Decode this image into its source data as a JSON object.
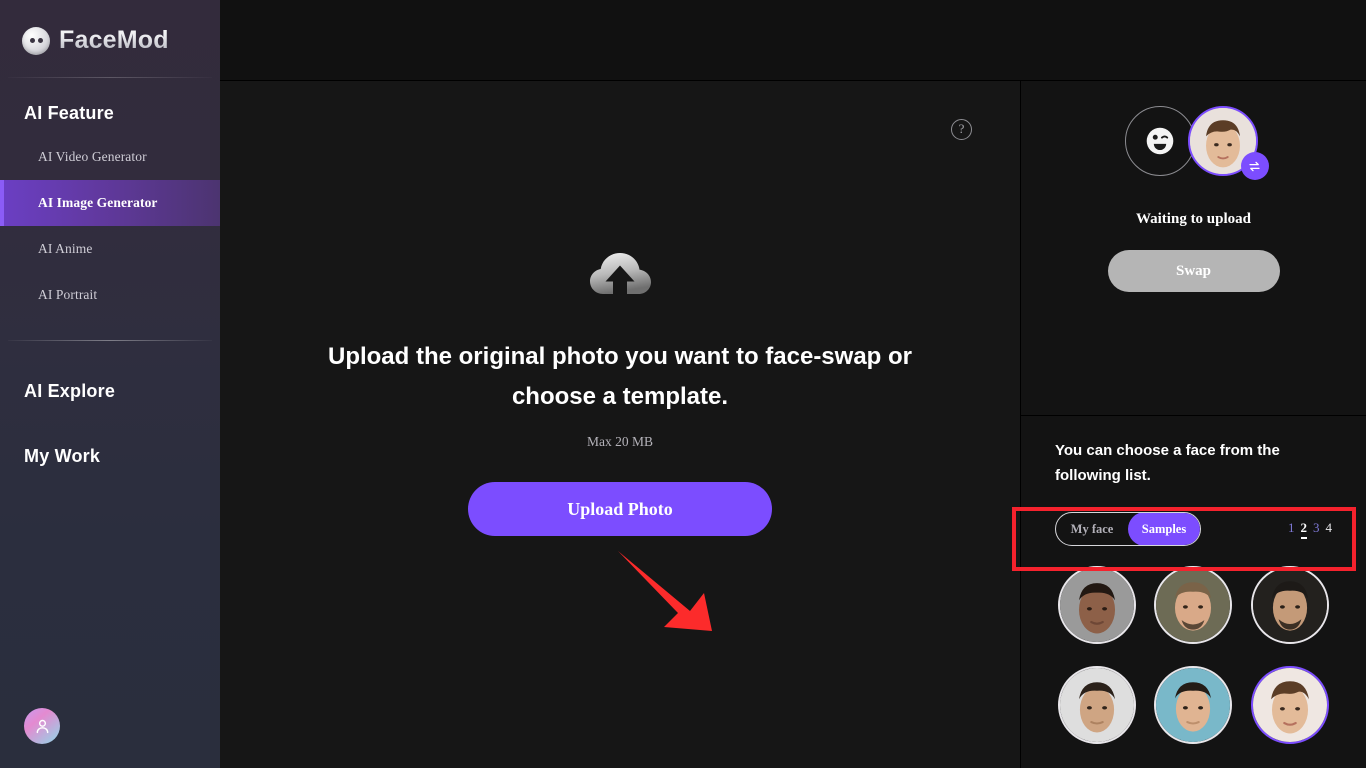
{
  "brand": {
    "name": "FaceMod",
    "logo_icon": "face-circle-icon"
  },
  "sidebar": {
    "section_feature_title": "AI Feature",
    "nav_items": [
      {
        "label": "AI Video Generator",
        "active": false
      },
      {
        "label": "AI Image Generator",
        "active": true
      },
      {
        "label": "AI Anime",
        "active": false
      },
      {
        "label": "AI Portrait",
        "active": false
      }
    ],
    "explore_label": "AI Explore",
    "my_work_label": "My Work",
    "avatar_icon": "user-avatar-icon"
  },
  "main": {
    "help_icon": "question-mark-icon",
    "upload_icon": "cloud-upload-icon",
    "headline": "Upload the original photo you want to face-swap or choose a template.",
    "max_size": "Max 20 MB",
    "upload_button": "Upload Photo",
    "annotation_arrow": "red-arrow-pointing-to-upload-button"
  },
  "right_panel": {
    "source_face_icon": "winking-face-placeholder-icon",
    "target_face": "selected-face-thumbnail",
    "swap_toggle_icon": "swap-arrows-icon",
    "status_text": "Waiting to upload",
    "swap_button": "Swap",
    "swap_button_state": "disabled",
    "choose_text": "You can choose a face from the following list.",
    "segmented": {
      "options": [
        {
          "label": "My face",
          "active": false
        },
        {
          "label": "Samples",
          "active": true
        }
      ]
    },
    "pagination": {
      "pages": [
        {
          "label": "1",
          "active": false,
          "style": "link"
        },
        {
          "label": "2",
          "active": true,
          "style": "current"
        },
        {
          "label": "3",
          "active": false,
          "style": "link"
        },
        {
          "label": "4",
          "active": false,
          "style": "white"
        }
      ]
    },
    "faces": [
      {
        "name": "face-1",
        "selected": false,
        "skin": "#8d6048",
        "skin2": "#6e4736",
        "hair": "#221812",
        "bg": "#9a9a9a"
      },
      {
        "name": "face-2",
        "selected": false,
        "skin": "#d9a988",
        "skin2": "#b9855f",
        "hair": "#7a6348",
        "bg": "#6d6b55"
      },
      {
        "name": "face-3",
        "selected": false,
        "skin": "#c49a78",
        "skin2": "#9e7450",
        "hair": "#1d1a17",
        "bg": "#23211e"
      },
      {
        "name": "face-4",
        "selected": false,
        "skin": "#cfa583",
        "skin2": "#ad8260",
        "hair": "#2b211a",
        "bg": "#dedede"
      },
      {
        "name": "face-5",
        "selected": false,
        "skin": "#e0b492",
        "skin2": "#bd8f6c",
        "hair": "#241c16",
        "bg": "#79b8c9"
      },
      {
        "name": "face-6",
        "selected": true,
        "skin": "#e3bb99",
        "skin2": "#c3946f",
        "hair": "#5b3d26",
        "bg": "#efe7e2"
      }
    ]
  },
  "colors": {
    "accent_purple": "#7c4dff",
    "annotation_red": "#f5222d",
    "sidebar_top": "#332b3c",
    "sidebar_bottom": "#2a2e3d",
    "panel_bg": "#161616"
  }
}
